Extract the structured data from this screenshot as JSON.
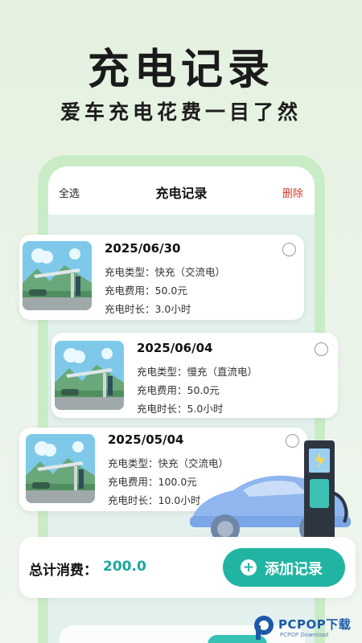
{
  "promo": {
    "headline": "充电记录",
    "subline": "爱车充电花费一目了然"
  },
  "app": {
    "header": {
      "select_all": "全选",
      "title": "充电记录",
      "delete": "删除"
    },
    "records": [
      {
        "date": "2025/06/30",
        "type": "充电类型：快充（交流电）",
        "cost": "充电费用：50.0元",
        "duration": "充电时长：3.0小时",
        "selected": false
      },
      {
        "date": "2025/06/04",
        "type": "充电类型：慢充（直流电）",
        "cost": "充电费用：50.0元",
        "duration": "充电时长：5.0小时",
        "selected": false
      },
      {
        "date": "2025/05/04",
        "type": "充电类型：快充（交流电）",
        "cost": "充电费用：100.0元",
        "duration": "充电时长：10.0小时",
        "selected": false
      }
    ],
    "total": {
      "label": "总计消费：",
      "value": "200.0"
    },
    "add_button": {
      "icon": "plus-icon",
      "label": "添加记录"
    }
  },
  "watermark": {
    "brand": "PCPOP下载",
    "sub": "PCPOP Download"
  },
  "colors": {
    "accent": "#21b4a3",
    "delete": "#d43a2a",
    "total_value": "#1aa89a"
  }
}
